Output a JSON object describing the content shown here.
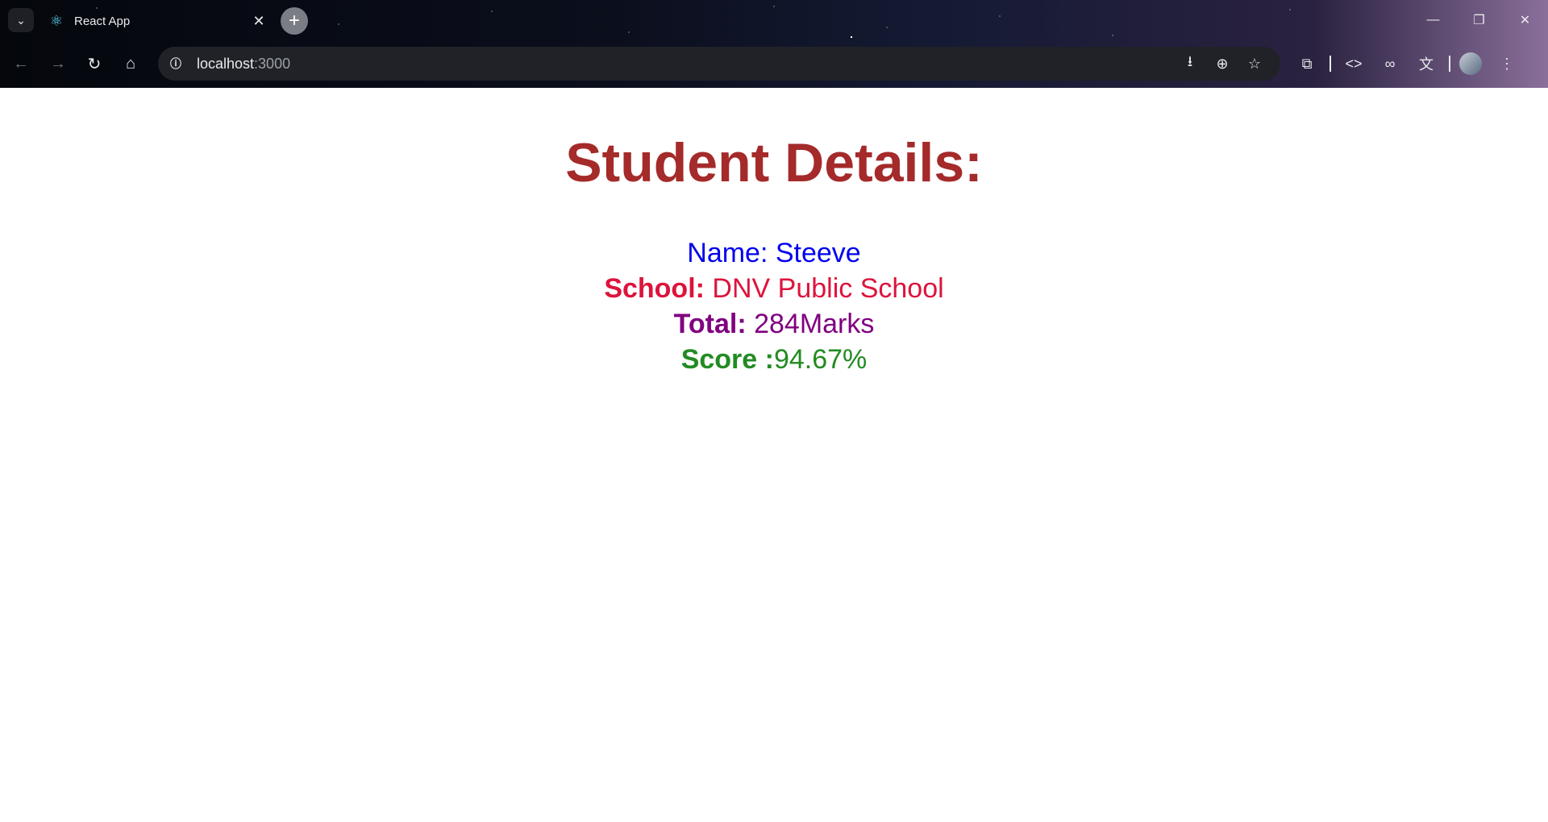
{
  "browser": {
    "tab": {
      "title": "React App",
      "favicon": "react-logo-icon"
    },
    "address": {
      "host": "localhost",
      "port": ":3000"
    },
    "icons": {
      "tab_search": "chevron-down-icon",
      "new_tab": "plus-icon",
      "back": "arrow-left-icon",
      "forward": "arrow-right-icon",
      "reload": "reload-icon",
      "home": "home-icon",
      "site_info": "info-icon",
      "install": "install-app-icon",
      "zoom": "zoom-icon",
      "bookmark": "star-icon",
      "extensions": "puzzle-icon",
      "devtools": "code-icon",
      "link": "link-icon",
      "translate": "translate-icon",
      "menu": "more-vertical-icon"
    }
  },
  "page": {
    "title": "Student Details:",
    "details": {
      "name_label": "Name:",
      "name_value": " Steeve",
      "school_label": "School:",
      "school_value": " DNV Public School",
      "total_label": "Total:",
      "total_value": " 284Marks",
      "score_label": "Score :",
      "score_value": "94.67%"
    }
  },
  "colors": {
    "title": "#a52a2a",
    "name": "#0000ee",
    "school": "#dc143c",
    "total": "#800080",
    "score": "#228b22"
  }
}
